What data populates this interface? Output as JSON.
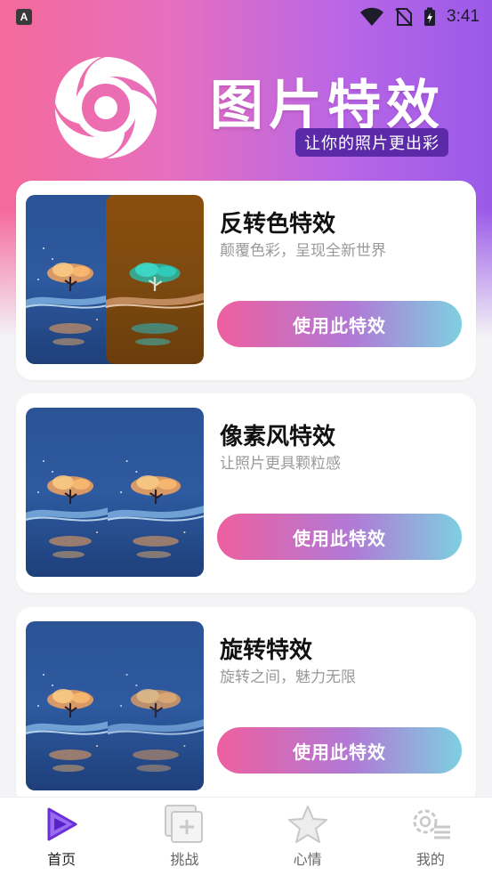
{
  "status_bar": {
    "app_badge": "A",
    "time": "3:41",
    "icons": [
      "wifi-icon",
      "no-sim-icon",
      "battery-charging-icon"
    ]
  },
  "header": {
    "title": "图片特效",
    "subtitle": "让你的照片更出彩",
    "logo": "aperture-logo"
  },
  "effects": [
    {
      "title": "反转色特效",
      "description": "颠覆色彩，呈现全新世界",
      "button_label": "使用此特效"
    },
    {
      "title": "像素风特效",
      "description": "让照片更具颗粒感",
      "button_label": "使用此特效"
    },
    {
      "title": "旋转特效",
      "description": "旋转之间，魅力无限",
      "button_label": "使用此特效"
    }
  ],
  "tab_bar": {
    "active": 0,
    "tabs": [
      {
        "label": "首页",
        "icon": "play-icon"
      },
      {
        "label": "挑战",
        "icon": "add-square-icon"
      },
      {
        "label": "心情",
        "icon": "star-icon"
      },
      {
        "label": "我的",
        "icon": "settings-list-icon"
      }
    ]
  },
  "colors": {
    "accent_purple": "#7b3fe4",
    "button_gradient_start": "#ee5fa0",
    "button_gradient_end": "#7dd0e0",
    "subtitle_pill": "#5a2aa8"
  }
}
